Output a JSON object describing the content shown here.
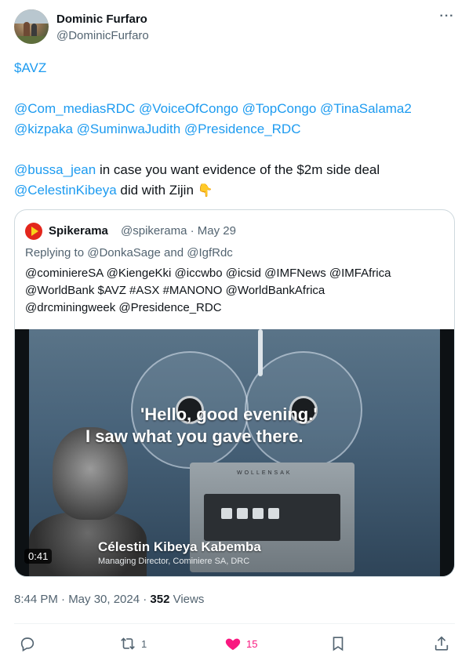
{
  "author": {
    "name": "Dominic Furfaro",
    "handle": "@DominicFurfaro"
  },
  "tweet": {
    "line1": "$AVZ",
    "mentions_a": "@Com_mediasRDC @VoiceOfCongo @TopCongo @TinaSalama2",
    "mentions_b": "@kizpaka @SuminwaJudith @Presidence_RDC",
    "mention_c": "@bussa_jean",
    "text_c": " in case you want evidence of the $2m side deal",
    "mention_d": "@CelestinKibeya",
    "text_d": " did with Zijin ",
    "emoji": "👇"
  },
  "quote": {
    "name": "Spikerama",
    "meta": "@spikerama · May 29",
    "replying_prefix": "Replying to ",
    "replying_a": "@DonkaSage",
    "replying_and": " and ",
    "replying_b": "@IgfRdc",
    "body_line1": "@cominiereSA @KiengeKki @iccwbo @icsid @IMFNews @IMFAfrica",
    "body_line2": "@WorldBank $AVZ #ASX #MANONO @WorldBankAfrica",
    "body_line3": "@drcminingweek @Presidence_RDC",
    "video": {
      "caption_line1": "'Hello, good evening.'",
      "caption_line2": "I saw what you gave there.",
      "person_name": "Célestin Kibeya Kabemba",
      "person_title": "Managing Director, Cominiere SA, DRC",
      "duration": "0:41",
      "deck_brand": "WOLLENSAK"
    }
  },
  "timestamp": {
    "time": "8:44 PM · May 30, 2024 · ",
    "views_count": "352",
    "views_label": " Views"
  },
  "actions": {
    "retweet_count": "1",
    "like_count": "15"
  },
  "colors": {
    "link": "#1d9bf0",
    "like": "#f91880",
    "secondary": "#536471"
  }
}
